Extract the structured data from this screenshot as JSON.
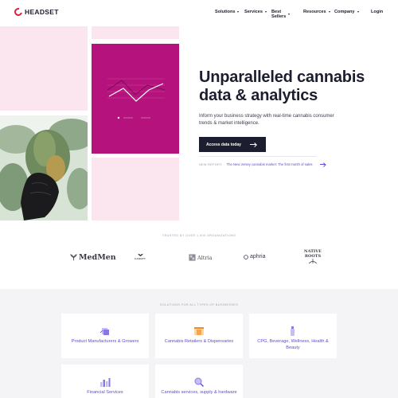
{
  "brand": {
    "name": "HEADSET"
  },
  "nav": {
    "items": [
      {
        "label": "Solutions"
      },
      {
        "label": "Services"
      },
      {
        "label": "Best Sellers"
      },
      {
        "label": "Resources"
      },
      {
        "label": "Company"
      }
    ],
    "login": "Login"
  },
  "hero": {
    "title": "Unparalleled cannabis data & analytics",
    "subtitle": "Inform your business strategy with real-time cannabis consumer trends & market intelligence.",
    "cta_label": "Access data today",
    "report_label": "NEW REPORT:",
    "report_link": "The New Jersey cannabis market: The first month of sales"
  },
  "trusted": {
    "label": "TRUSTED BY OVER 1,000 ORGANIZATIONS",
    "partners": [
      {
        "name": "MedMen"
      },
      {
        "name": "CANOPY"
      },
      {
        "name": "Altria"
      },
      {
        "name": "aphria"
      },
      {
        "name": "NATIVE ROOTS"
      }
    ]
  },
  "solutions": {
    "label": "SOLUTIONS FOR ALL TYPES OF BUSINESSES",
    "cards": [
      {
        "label": "Product Manufacturers & Growers",
        "icon": "box-icon"
      },
      {
        "label": "Cannabis Retailers & Dispensaries",
        "icon": "store-icon"
      },
      {
        "label": "CPG, Beverage, Wellness, Health & Beauty",
        "icon": "bottle-icon"
      },
      {
        "label": "Financial Services",
        "icon": "chart-icon"
      },
      {
        "label": "Cannabis services, supply & hardware",
        "icon": "magnify-icon"
      }
    ]
  },
  "colors": {
    "accent": "#5e4bd8",
    "magenta": "#b5127d",
    "pink_tile": "#fbe6f0",
    "dark": "#1c1d2e",
    "logo_red": "#e0213c"
  }
}
